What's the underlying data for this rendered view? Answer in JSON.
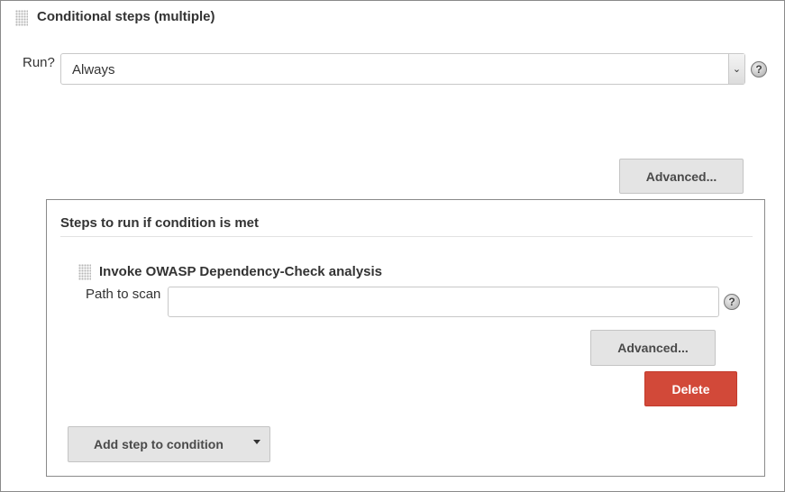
{
  "section": {
    "title": "Conditional steps (multiple)",
    "run_label": "Run?",
    "run_select": {
      "value": "Always"
    },
    "help_icon": "help-icon",
    "advanced_label": "Advanced..."
  },
  "inner": {
    "title": "Steps to run if condition is met",
    "step": {
      "title": "Invoke OWASP Dependency-Check analysis",
      "path_label": "Path to scan",
      "path_value": "",
      "advanced_label": "Advanced...",
      "delete_label": "Delete"
    },
    "add_step_label": "Add step to condition"
  },
  "colors": {
    "delete_button": "#d24939",
    "button_bg": "#e4e4e4",
    "border": "#8a8a8a"
  }
}
